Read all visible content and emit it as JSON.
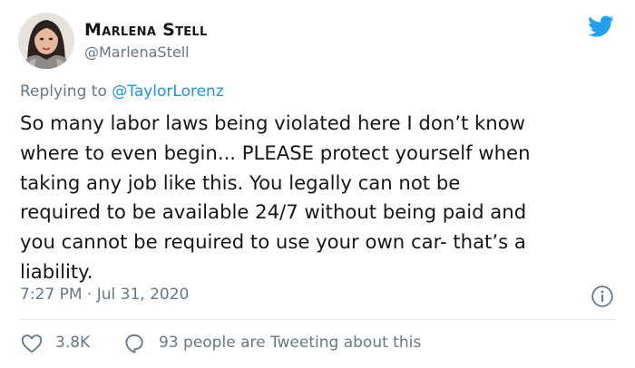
{
  "author": {
    "display_name": "Marlena Stell",
    "handle": "@MarlenaStell"
  },
  "reply": {
    "prefix": "Replying to ",
    "mention": "@TaylorLorenz"
  },
  "tweet": {
    "lines": [
      "So many labor laws being violated here I don’t know",
      "where to even begin... PLEASE protect yourself when",
      "taking any job like this. You legally can not be",
      "required to be available 24/7 without being paid and",
      "you cannot be required to use your own car- that’s a",
      "liability."
    ]
  },
  "timestamp": "7:27 PM · Jul 31, 2020",
  "actions": {
    "likes": "3.8K",
    "conversation": "93 people are Tweeting about this"
  },
  "icons": {
    "brand": "twitter-bird-icon",
    "info": "info-icon",
    "like": "heart-icon",
    "reply": "speech-bubble-icon"
  },
  "colors": {
    "brand_blue": "#1da1f2",
    "mention_blue": "#1b95e0",
    "muted_text": "#657786",
    "primary_text": "#14171a",
    "divider": "#e1e8ed"
  }
}
